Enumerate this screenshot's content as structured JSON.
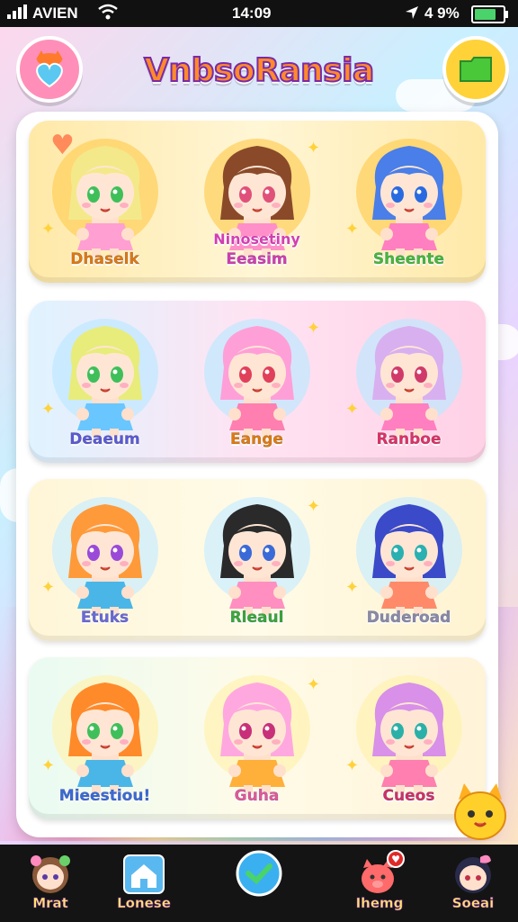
{
  "status_bar": {
    "carrier": "AVIEN",
    "time": "14:09",
    "battery": "4 9%",
    "battery_level": 0.9
  },
  "header": {
    "title": "VnbsoRansia",
    "left_icon": "fox-heart-icon",
    "right_icon": "folder-icon"
  },
  "colors": {
    "accent_title": "#ff8a2a",
    "title_outline": "#7a2aa8",
    "nav_bg": "#141414"
  },
  "rows": [
    {
      "theme": "yellow",
      "cells": [
        {
          "label": "Dhaselk",
          "color": "#e07a10",
          "hair": "#f4e98a",
          "eyes": "#3fbf5a",
          "dress": "#ff9fd2"
        },
        {
          "label": "Eeasim",
          "badge": "Ninosetiny",
          "color": "#d23fb0",
          "hair": "#8a4a2a",
          "eyes": "#e0507a",
          "dress": "#ff8fc8"
        },
        {
          "label": "Sheente",
          "color": "#48b83a",
          "hair": "#4a7ee8",
          "eyes": "#2a6ae0",
          "dress": "#ff7fc0"
        }
      ]
    },
    {
      "theme": "pink",
      "cells": [
        {
          "label": "Deaeum",
          "color": "#5a5ad8",
          "hair": "#e8ec7a",
          "eyes": "#3fbf5a",
          "dress": "#6ac6ff"
        },
        {
          "label": "Eange",
          "color": "#e07a10",
          "hair": "#ff9fd8",
          "eyes": "#e0405a",
          "dress": "#ff7fb0"
        },
        {
          "label": "Ranboe",
          "color": "#e0306a",
          "hair": "#d8b0f0",
          "eyes": "#d03a6a",
          "dress": "#ff7fc0"
        }
      ]
    },
    {
      "theme": "cream",
      "cells": [
        {
          "label": "Etuks",
          "color": "#6a6ad8",
          "hair": "#ff9a3a",
          "eyes": "#9a4ad8",
          "dress": "#4ab6e8"
        },
        {
          "label": "Rleaul",
          "color": "#3aa83a",
          "hair": "#2a2a2a",
          "eyes": "#3a6ad8",
          "dress": "#ff8fc0"
        },
        {
          "label": "Duderoad",
          "color": "#8a8aa8",
          "hair": "#3a4ac8",
          "eyes": "#2ab0b0",
          "dress": "#ff8a6a"
        }
      ]
    },
    {
      "theme": "mint",
      "cells": [
        {
          "label": "Mieestiou!",
          "color": "#3a6ad8",
          "hair": "#ff8a2a",
          "eyes": "#3fbf5a",
          "dress": "#4ab6e8"
        },
        {
          "label": "Guha",
          "color": "#e05a9a",
          "hair": "#ffa8e0",
          "eyes": "#c8307a",
          "dress": "#ffb03a"
        },
        {
          "label": "Cueos",
          "color": "#d0306a",
          "hair": "#d890e8",
          "eyes": "#2ab0a8",
          "dress": "#ff7fb0"
        }
      ]
    }
  ],
  "nav": [
    {
      "label": "Mrat",
      "icon": "girl-avatar-icon"
    },
    {
      "label": "Lonese",
      "icon": "house-icon"
    },
    {
      "label": "",
      "icon": "heart-check-icon"
    },
    {
      "label": "Ihemg",
      "icon": "pig-notification-icon",
      "badge": "heart"
    },
    {
      "label": "Soeai",
      "icon": "dark-hair-girl-icon"
    }
  ]
}
